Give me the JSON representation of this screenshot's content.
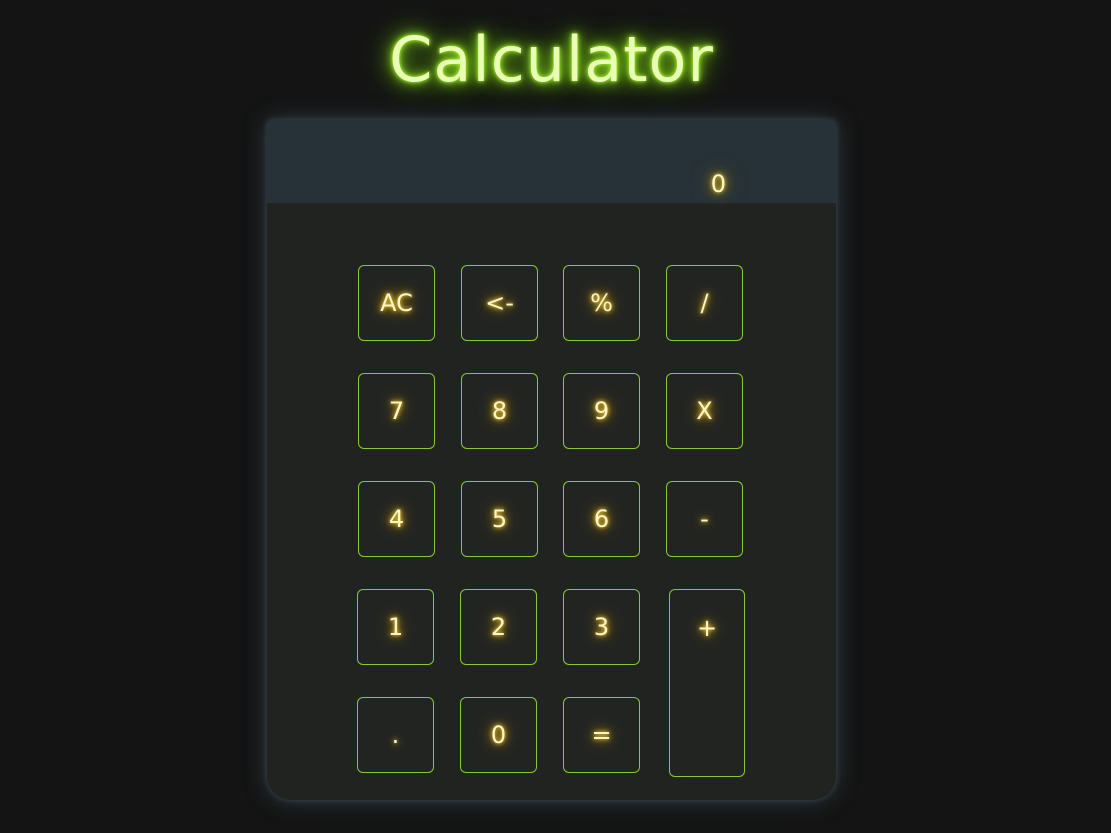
{
  "app": {
    "title": "Calculator"
  },
  "display": {
    "value": "0"
  },
  "keys": {
    "ac": "AC",
    "backspace": "<-",
    "percent": "%",
    "divide": "/",
    "seven": "7",
    "eight": "8",
    "nine": "9",
    "multiply": "X",
    "four": "4",
    "five": "5",
    "six": "6",
    "minus": "-",
    "one": "1",
    "two": "2",
    "three": "3",
    "plus": "+",
    "dot": ".",
    "zero": "0",
    "equals": "="
  },
  "colors": {
    "background": "#141414",
    "title_glow": "#8fe81e",
    "key_border": "#86c935",
    "key_text_glow": "#ffd84a",
    "display_panel": "#263138",
    "body_panel": "#212321"
  }
}
